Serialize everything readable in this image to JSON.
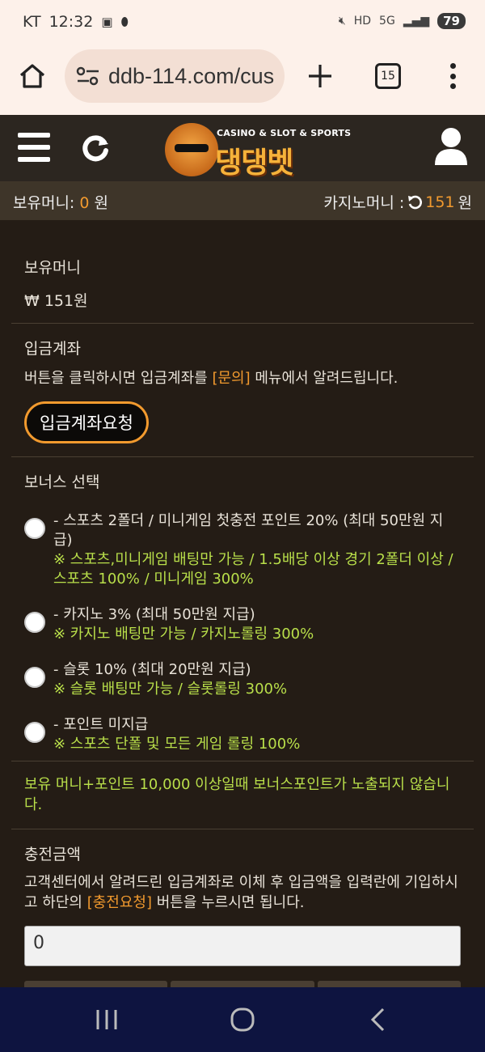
{
  "status": {
    "carrier": "KT",
    "time": "12:32",
    "battery": "79",
    "icons": [
      "image-icon",
      "link-icon",
      "mute-icon",
      "hd-icon",
      "5g-icon",
      "signal-icon"
    ]
  },
  "browser": {
    "url": "ddb-114.com/cus",
    "tab_count": "15"
  },
  "header": {
    "logo_tagline": "CASINO & SLOT & SPORTS",
    "logo_name": "댕댕벳"
  },
  "money": {
    "held_label": "보유머니: ",
    "held_value": "0",
    "held_unit": " 원",
    "casino_label": "카지노머니 : ",
    "casino_value": "151",
    "casino_unit": " 원"
  },
  "balance": {
    "title": "보유머니",
    "value": "₩ 151원"
  },
  "account": {
    "title": "입금계좌",
    "desc_before": "버튼을 클릭하시면 입금계좌를 ",
    "desc_link": "[문의]",
    "desc_after": " 메뉴에서 알려드립니다.",
    "button": "입금계좌요청"
  },
  "bonus": {
    "title": "보너스 선택",
    "options": [
      {
        "main": "- 스포츠 2폴더 / 미니게임 첫충전 포인트 20% (최대 50만원 지급)",
        "note": "※ 스포츠,미니게임 배팅만 가능 / 1.5배당 이상 경기 2폴더 이상 / 스포츠 100% / 미니게임 300%"
      },
      {
        "main": "- 카지노 3% (최대 50만원 지급)",
        "note": "※ 카지노 배팅만 가능 / 카지노롤링 300%"
      },
      {
        "main": "- 슬롯 10% (최대 20만원 지급)",
        "note": "※ 슬롯 배팅만 가능 / 슬롯롤링 300%"
      },
      {
        "main": "- 포인트 미지급",
        "note": "※ 스포츠 단폴 및 모든 게임 롤링 100%"
      }
    ]
  },
  "notice": "보유 머니+포인트 10,000 이상일때 보너스포인트가 노출되지 않습니다.",
  "charge": {
    "title": "충전금액",
    "desc_before": "고객센터에서 알려드린 입금계좌로 이체 후 입금액을 입력란에 기입하시고 하단의 ",
    "desc_link": "[충전요청]",
    "desc_after": " 버튼을 누르시면 됩니다.",
    "amount_value": "0"
  }
}
